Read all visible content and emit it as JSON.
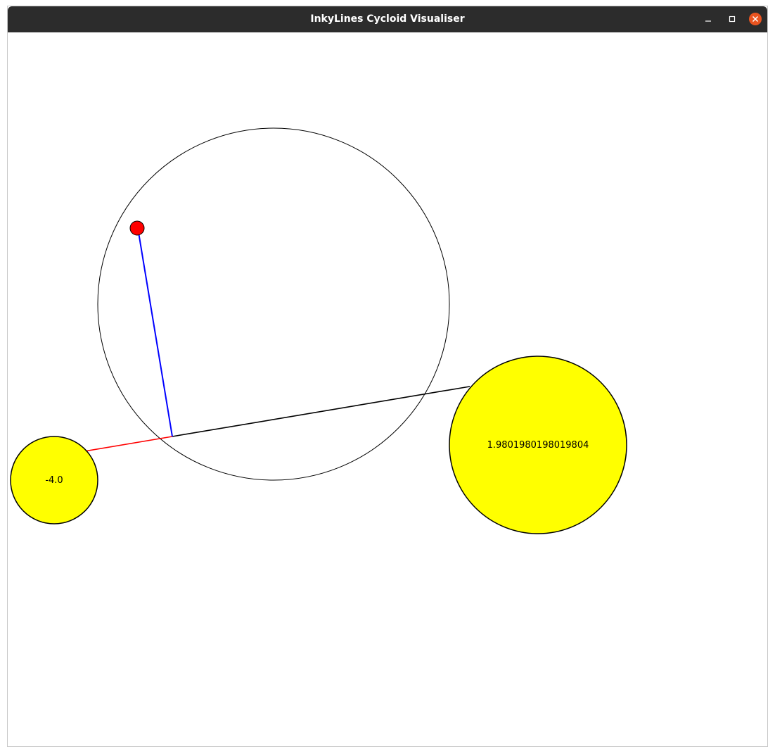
{
  "window": {
    "title": "InkyLines Cycloid Visualiser",
    "controls": [
      "minimize-icon",
      "maximize-icon",
      "close-icon"
    ]
  },
  "colors": {
    "titlebar": "#2c2c2c",
    "close_button": "#e95420",
    "wheel_fill": "#ffff00",
    "pen_dot": "#ff0000",
    "arm_blue": "#0000ff",
    "arm_red": "#ff0000",
    "outline": "#000000"
  },
  "visualiser": {
    "small_wheel": {
      "label": "-4.0"
    },
    "large_wheel": {
      "label": "1.9801980198019804"
    }
  }
}
